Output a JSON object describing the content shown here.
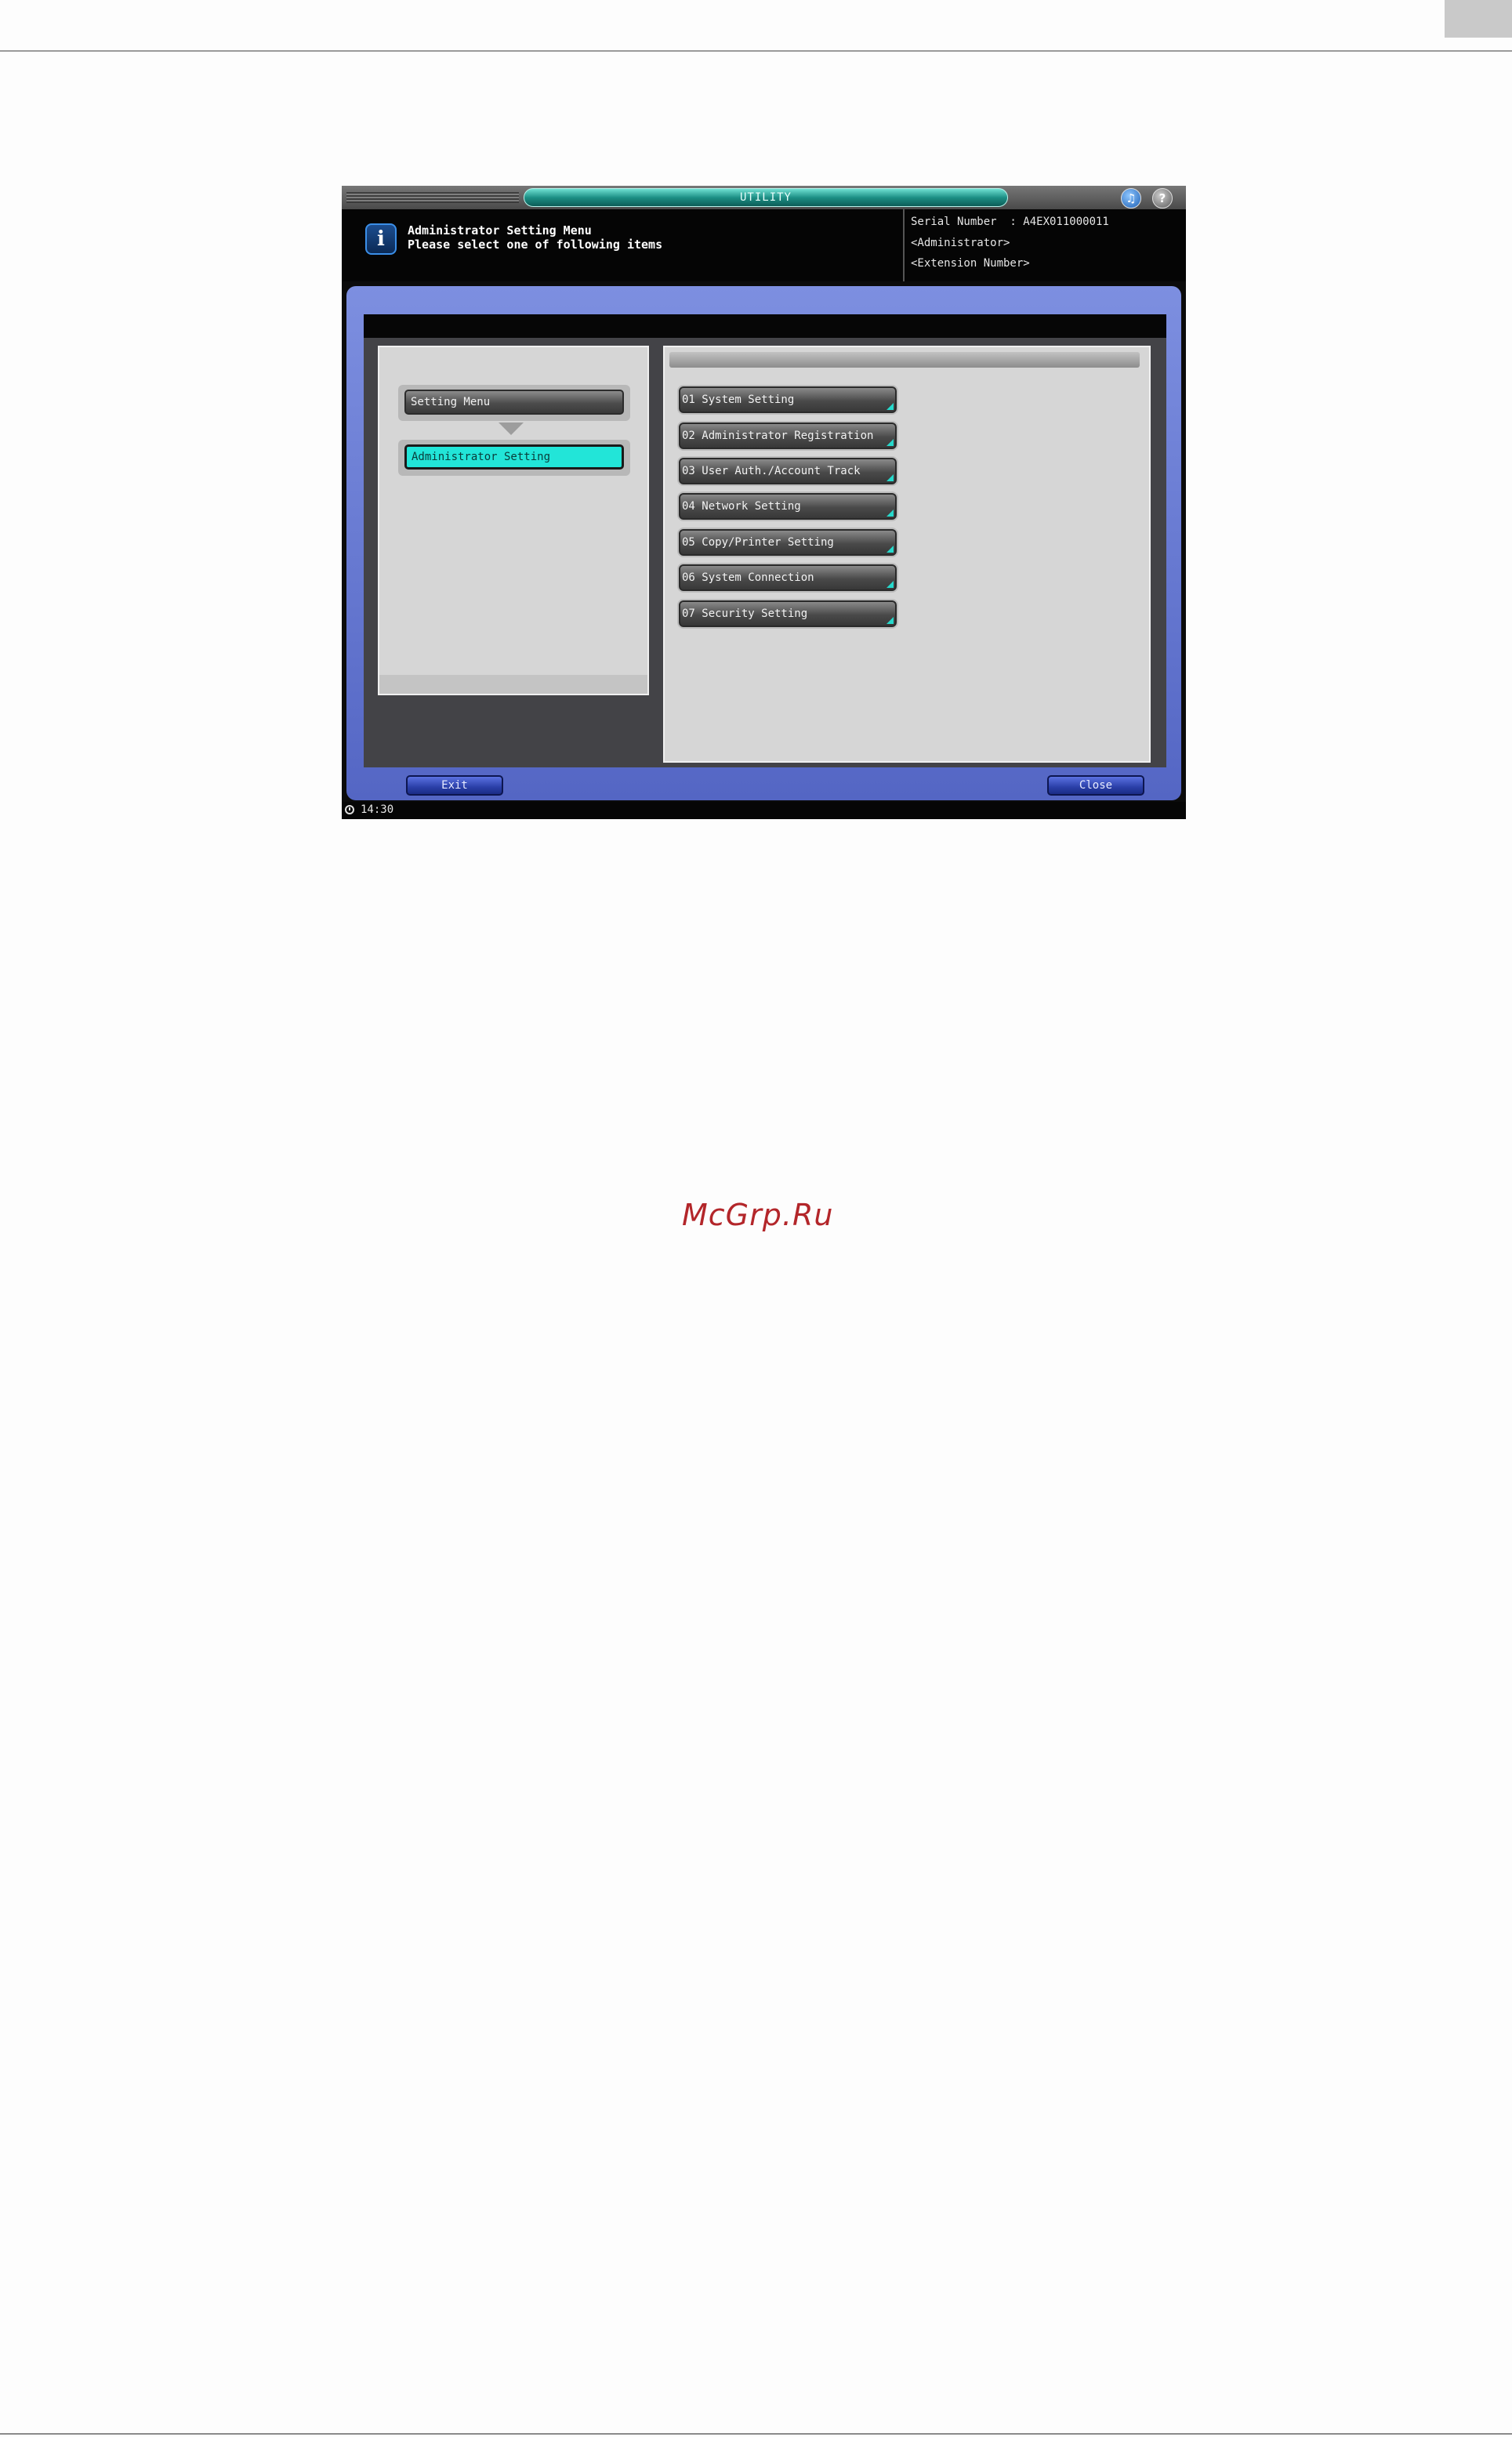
{
  "titlebar": {
    "title": "UTILITY"
  },
  "message": {
    "line1": "Administrator Setting Menu",
    "line2": "Please select one of following items"
  },
  "device_info": {
    "serial": "Serial Number  : A4EX011000011",
    "user": "<Administrator>",
    "extension": "<Extension Number>"
  },
  "breadcrumb": {
    "items": [
      {
        "label": "Setting Menu",
        "state": "parent"
      },
      {
        "label": "Administrator Setting",
        "state": "active"
      }
    ]
  },
  "menu": {
    "items": [
      {
        "label": "01 System Setting"
      },
      {
        "label": "02 Administrator Registration"
      },
      {
        "label": "03 User Auth./Account Track"
      },
      {
        "label": "04 Network Setting"
      },
      {
        "label": "05 Copy/Printer Setting"
      },
      {
        "label": "06 System Connection"
      },
      {
        "label": "07 Security Setting"
      }
    ]
  },
  "footer": {
    "exit_label": "Exit",
    "close_label": "Close"
  },
  "status": {
    "time": "14:30"
  },
  "watermark": "McGrp.Ru",
  "colors": {
    "accent_cyan": "#22e5d8",
    "frame_blue": "#5466c4",
    "watermark_red": "#b3262a"
  },
  "icons": [
    "info-icon",
    "speaker-icon",
    "help-icon",
    "clock-icon",
    "down-arrow-icon"
  ]
}
